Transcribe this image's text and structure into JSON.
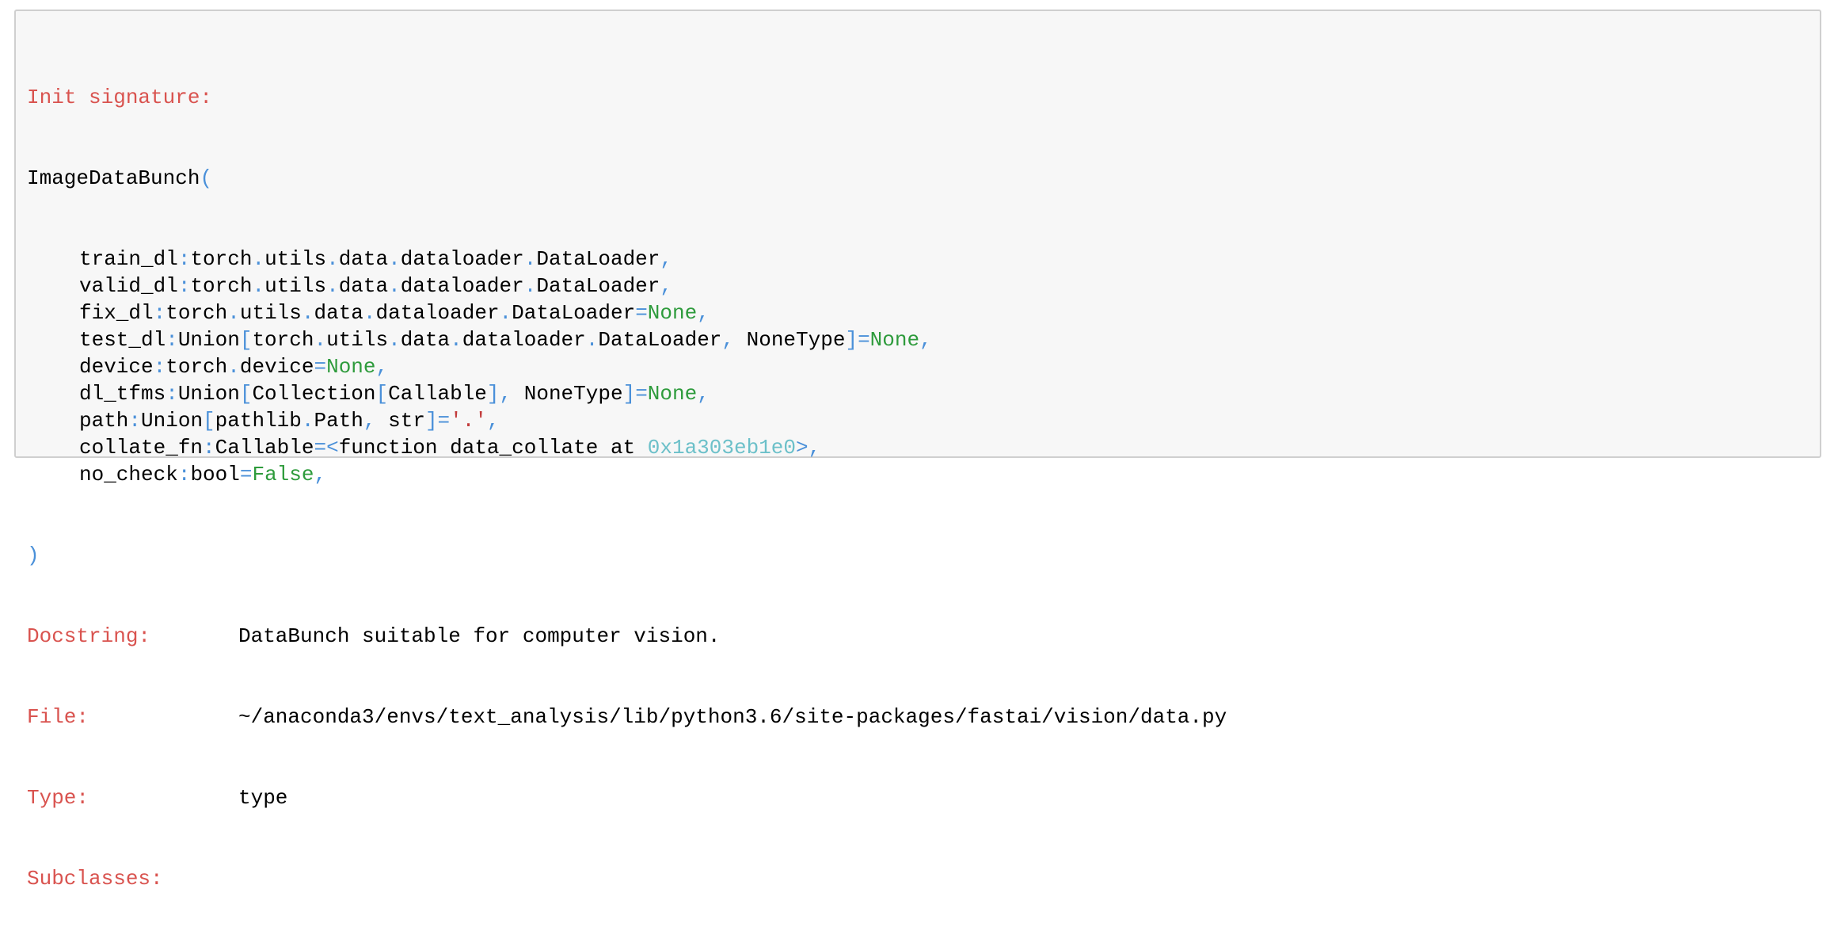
{
  "header": {
    "label": "Init signature:"
  },
  "signature": {
    "class_name": "ImageDataBunch",
    "open_paren": "(",
    "close_paren": ")",
    "params": [
      {
        "name": "train_dl",
        "type_parts": [
          "torch",
          ".",
          "utils",
          ".",
          "data",
          ".",
          "dataloader",
          ".",
          "DataLoader"
        ],
        "default": ""
      },
      {
        "name": "valid_dl",
        "type_parts": [
          "torch",
          ".",
          "utils",
          ".",
          "data",
          ".",
          "dataloader",
          ".",
          "DataLoader"
        ],
        "default": ""
      },
      {
        "name": "fix_dl",
        "type_parts": [
          "torch",
          ".",
          "utils",
          ".",
          "data",
          ".",
          "dataloader",
          ".",
          "DataLoader"
        ],
        "default": "None"
      },
      {
        "name": "test_dl",
        "type_parts": [
          "Union",
          "[",
          "torch",
          ".",
          "utils",
          ".",
          "data",
          ".",
          "dataloader",
          ".",
          "DataLoader",
          ", ",
          "NoneType",
          "]"
        ],
        "default": "None"
      },
      {
        "name": "device",
        "type_parts": [
          "torch",
          ".",
          "device"
        ],
        "default": "None"
      },
      {
        "name": "dl_tfms",
        "type_parts": [
          "Union",
          "[",
          "Collection",
          "[",
          "Callable",
          "]",
          ", ",
          "NoneType",
          "]"
        ],
        "default": "None"
      },
      {
        "name": "path",
        "type_parts": [
          "Union",
          "[",
          "pathlib",
          ".",
          "Path",
          ", ",
          "str",
          "]"
        ],
        "default": "'.'"
      },
      {
        "name": "collate_fn",
        "type_parts": [
          "Callable"
        ],
        "default_parts": [
          "<",
          "function data_collate at ",
          "0x1a303eb1e0",
          ">"
        ]
      },
      {
        "name": "no_check",
        "type_parts": [
          "bool"
        ],
        "default": "False"
      }
    ]
  },
  "info": {
    "docstring_label": "Docstring:",
    "docstring": "DataBunch suitable for computer vision.",
    "file_label": "File:",
    "file": "~/anaconda3/envs/text_analysis/lib/python3.6/site-packages/fastai/vision/data.py",
    "type_label": "Type:",
    "type": "type",
    "subclasses_label": "Subclasses:"
  },
  "colors": {
    "header": "#d9534f",
    "punctuation": "#4a90d9",
    "keyword": "#2e9b3c",
    "string": "#c23b3b",
    "address": "#6cc0c9",
    "background": "#f7f7f7",
    "border": "#cfcfcf"
  }
}
